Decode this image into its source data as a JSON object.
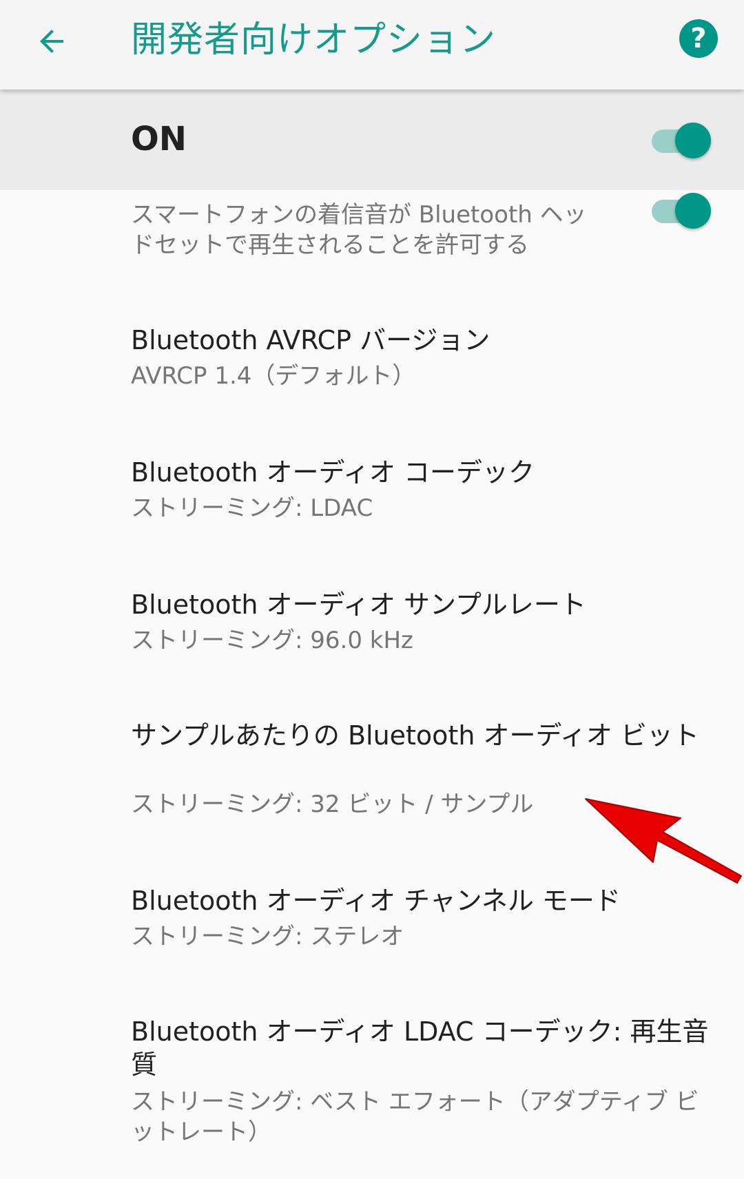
{
  "app_bar": {
    "title": "開発者向けオプション",
    "back_icon": "arrow-back-icon",
    "help_icon": "help-icon",
    "help_glyph": "?",
    "accent_color": "#009688"
  },
  "master_switch": {
    "label": "ON",
    "state": "on"
  },
  "settings": {
    "items": [
      {
        "summary": "スマートフォンの着信音が Bluetooth ヘッドセットで再生されることを許可する",
        "toggle": "on"
      },
      {
        "title": "Bluetooth AVRCP バージョン",
        "summary": "AVRCP 1.4（デフォルト）"
      },
      {
        "title": "Bluetooth オーディオ コーデック",
        "summary": "ストリーミング: LDAC"
      },
      {
        "title": "Bluetooth オーディオ サンプルレート",
        "summary": "ストリーミング: 96.0 kHz"
      },
      {
        "title": "サンプルあたりの Bluetooth オーディオ ビット",
        "summary": "ストリーミング: 32 ビット / サンプル"
      },
      {
        "title": "Bluetooth オーディオ チャンネル モード",
        "summary": "ストリーミング: ステレオ"
      },
      {
        "title": "Bluetooth オーディオ LDAC コーデック: 再生音質",
        "summary": "ストリーミング: ベスト エフォート（アダプティブ ビットレート）"
      }
    ]
  },
  "annotation": {
    "arrow_icon": "red-arrow-icon",
    "color": "#e60000"
  }
}
